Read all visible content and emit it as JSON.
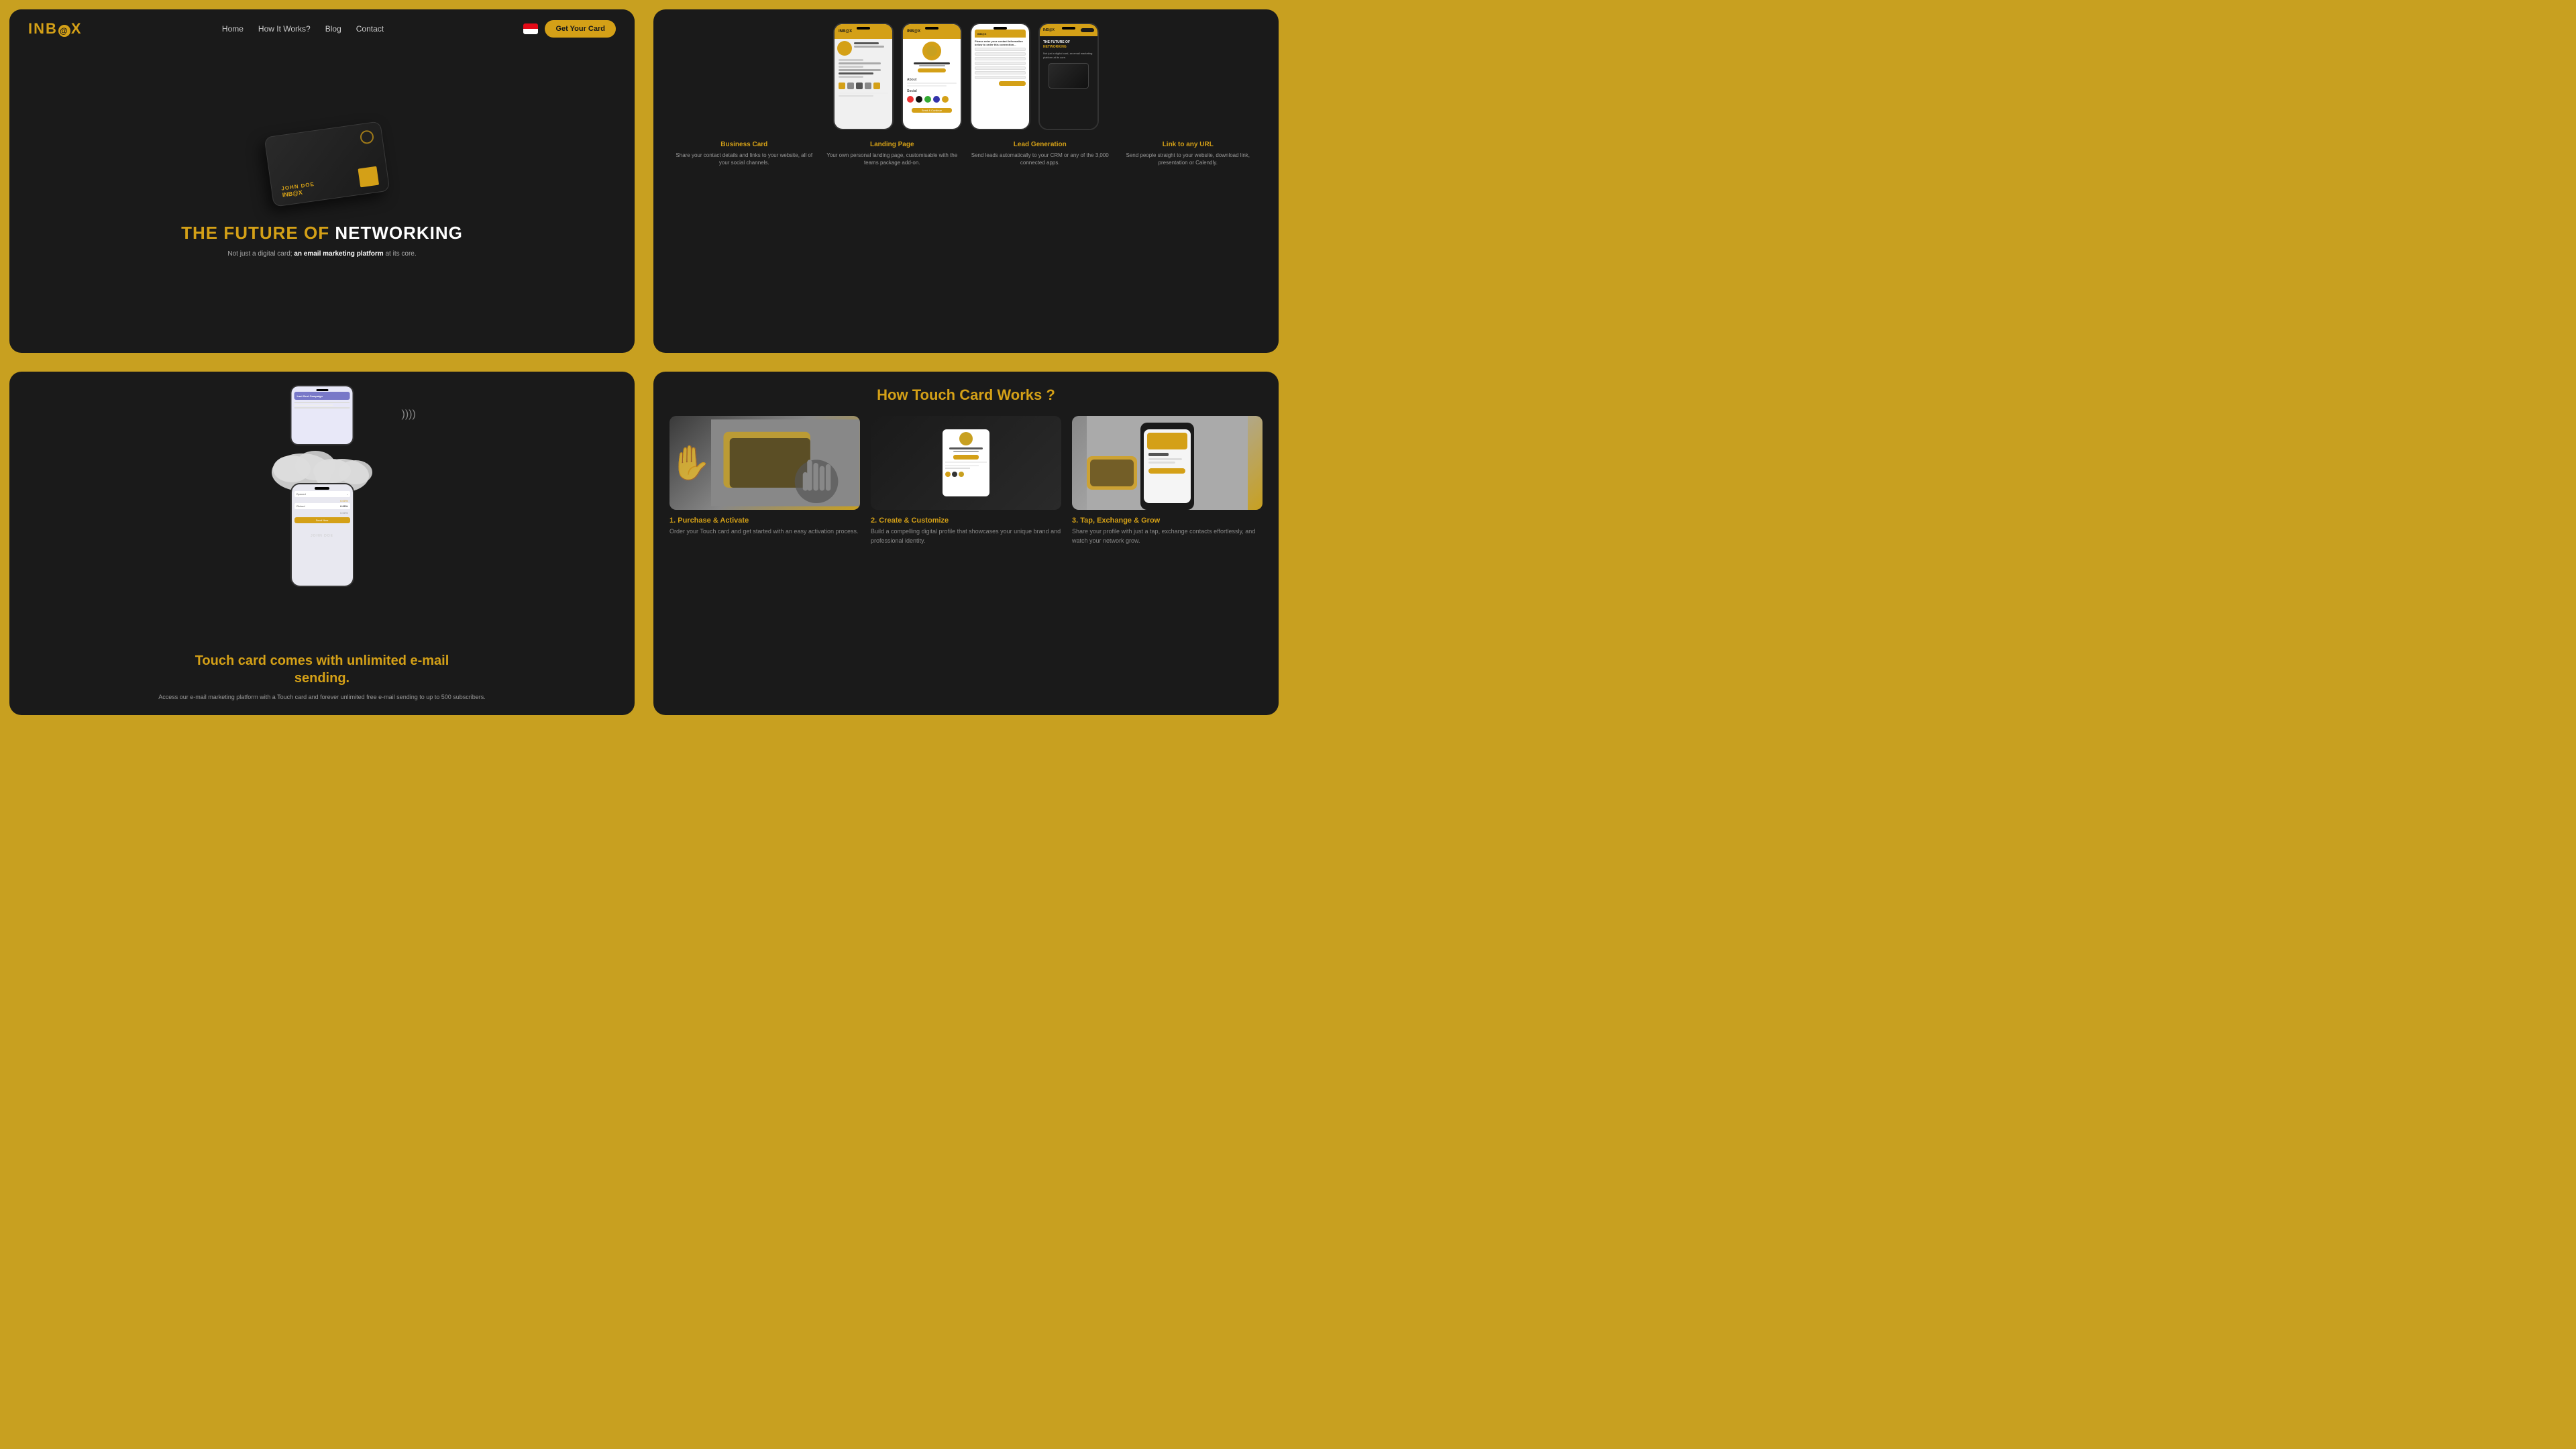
{
  "hero": {
    "logo": "INB",
    "logo_circle": "@",
    "logo_suffix": "X",
    "nav": {
      "links": [
        "Home",
        "How It Works?",
        "Blog",
        "Contact"
      ],
      "cta": "Get Your Card"
    },
    "card": {
      "name": "JOHN DOE",
      "logo_text": "INB@X"
    },
    "title_prefix": "THE FUTURE OF ",
    "title_highlight": "NETWORKING",
    "subtitle_before": "Not just a digital card;",
    "subtitle_em": " an email marketing platform",
    "subtitle_after": " at its core."
  },
  "features": {
    "section_label": "",
    "phones": [
      {
        "id": "phone1",
        "label": "Business Card"
      },
      {
        "id": "phone2",
        "label": "Landing Page"
      },
      {
        "id": "phone3",
        "label": "Lead Generation"
      },
      {
        "id": "phone4",
        "label": "Link to any URL"
      }
    ],
    "items": [
      {
        "title": "Business Card",
        "desc": "Share your contact details and links to your website, all of your social channels."
      },
      {
        "title": "Landing Page",
        "desc": "Your own personal landing page, customisable with the teams package add-on."
      },
      {
        "title": "Lead Generation",
        "desc": "Send leads automatically to your CRM or any of the 3,000 connected apps."
      },
      {
        "title": "Link to any URL",
        "desc": "Send people straight to your website, download link, presentation or Calendly."
      }
    ]
  },
  "email": {
    "heading_line1": "Touch card comes with unlimited e-mail",
    "heading_line2": "sending.",
    "desc": "Access our e-mail marketing platform with a Touch card and forever unlimited free e-mail sending to up to 500 subscribers.",
    "phone_label": "JOHN DOE",
    "campaign": {
      "header": "Last Sent Campaign",
      "opened_label": "Opened",
      "opened_val": "",
      "clicked_label": "Clicked",
      "clicked_val": "0.00%",
      "send_btn": "Send Now"
    }
  },
  "how": {
    "title": "How Touch Card Works ?",
    "steps": [
      {
        "number": "1. Purchase & Activate",
        "title": "Purchase & Activate",
        "desc": "Order your Touch card and get started with an easy activation process."
      },
      {
        "number": "2. Create & Customize",
        "title": "Create & Customize",
        "desc": "Build a compelling digital profile that showcases your unique brand and professional identity."
      },
      {
        "number": "3. Tap, Exchange & Grow",
        "title": "Tap, Exchange & Grow",
        "desc": "Share your profile with just a tap, exchange contacts effortlessly, and watch your network grow."
      }
    ]
  },
  "colors": {
    "gold": "#d4a017",
    "dark": "#1a1a1a",
    "text_muted": "#888888"
  }
}
